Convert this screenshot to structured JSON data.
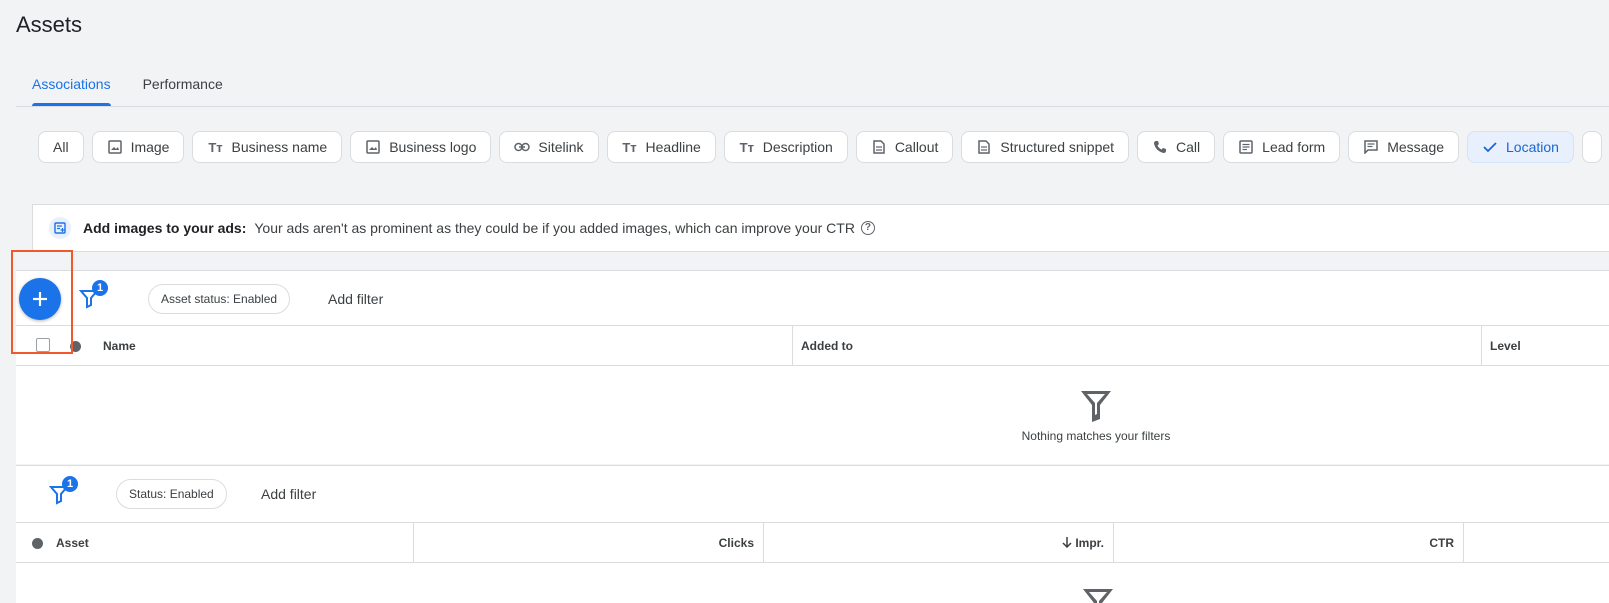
{
  "page": {
    "title": "Assets"
  },
  "tabs": [
    {
      "label": "Associations",
      "active": true
    },
    {
      "label": "Performance",
      "active": false
    }
  ],
  "chips": [
    {
      "label": "All",
      "icon": ""
    },
    {
      "label": "Image",
      "icon": "image-icon"
    },
    {
      "label": "Business name",
      "icon": "text-icon"
    },
    {
      "label": "Business logo",
      "icon": "image-icon"
    },
    {
      "label": "Sitelink",
      "icon": "link-icon"
    },
    {
      "label": "Headline",
      "icon": "text-icon"
    },
    {
      "label": "Description",
      "icon": "text-icon"
    },
    {
      "label": "Callout",
      "icon": "document-icon"
    },
    {
      "label": "Structured snippet",
      "icon": "document-icon"
    },
    {
      "label": "Call",
      "icon": "phone-icon"
    },
    {
      "label": "Lead form",
      "icon": "form-icon"
    },
    {
      "label": "Message",
      "icon": "message-icon"
    },
    {
      "label": "Location",
      "icon": "check-icon",
      "selected": true
    }
  ],
  "banner": {
    "title": "Add images to your ads:",
    "text": "Your ads aren't as prominent as they could be if you added images, which can improve your CTR",
    "icon": "add-image-icon",
    "help_glyph": "?"
  },
  "associations_table": {
    "filter_count": "1",
    "filter_pill": "Asset status: Enabled",
    "add_filter": "Add filter",
    "columns": [
      "Name",
      "Added to",
      "Level"
    ],
    "empty_message": "Nothing matches your filters"
  },
  "performance_table": {
    "filter_count": "1",
    "filter_pill": "Status: Enabled",
    "add_filter": "Add filter",
    "columns": [
      "Asset",
      "Clicks",
      "Impr.",
      "CTR"
    ],
    "sort_column": "Impr.",
    "sort_direction": "descending"
  },
  "colors": {
    "accent": "#1a73e8",
    "highlight": "#f2592a",
    "background": "#f1f3f4"
  }
}
